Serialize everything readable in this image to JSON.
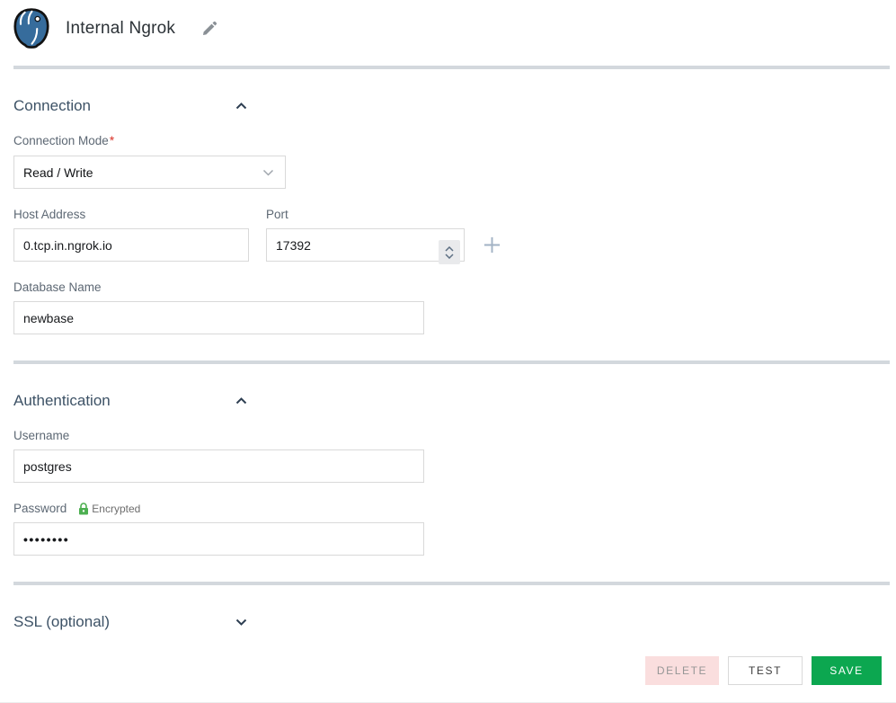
{
  "colors": {
    "section_title": "#3D5266",
    "divider": "#D3D8DD",
    "input_border": "#D9D9D9",
    "required_red": "#D93025",
    "lock_green": "#4CAF50",
    "save_green": "#0CA750",
    "delete_pink_bg": "#FADEDE",
    "plus_icon": "#A2B2C4"
  },
  "icons": {
    "logo": "postgresql-logo",
    "edit": "pencil-icon",
    "collapse": "chevron-up-icon",
    "expand": "chevron-down-icon",
    "select_arrow": "chevron-down-icon",
    "stepper": "spinner-up-down-icon",
    "add": "plus-icon",
    "secure": "lock-icon"
  },
  "header": {
    "title": "Internal Ngrok"
  },
  "connection": {
    "title": "Connection",
    "mode_label": "Connection Mode",
    "required_mark": "*",
    "mode_value": "Read / Write",
    "host_label": "Host Address",
    "host_value": "0.tcp.in.ngrok.io",
    "port_label": "Port",
    "port_value": "17392",
    "database_label": "Database Name",
    "database_value": "newbase"
  },
  "authentication": {
    "title": "Authentication",
    "username_label": "Username",
    "username_value": "postgres",
    "password_label": "Password",
    "password_badge": "Encrypted",
    "password_value": "••••••••"
  },
  "ssl": {
    "title": "SSL (optional)"
  },
  "actions": {
    "delete": "DELETE",
    "test": "TEST",
    "save": "SAVE"
  }
}
